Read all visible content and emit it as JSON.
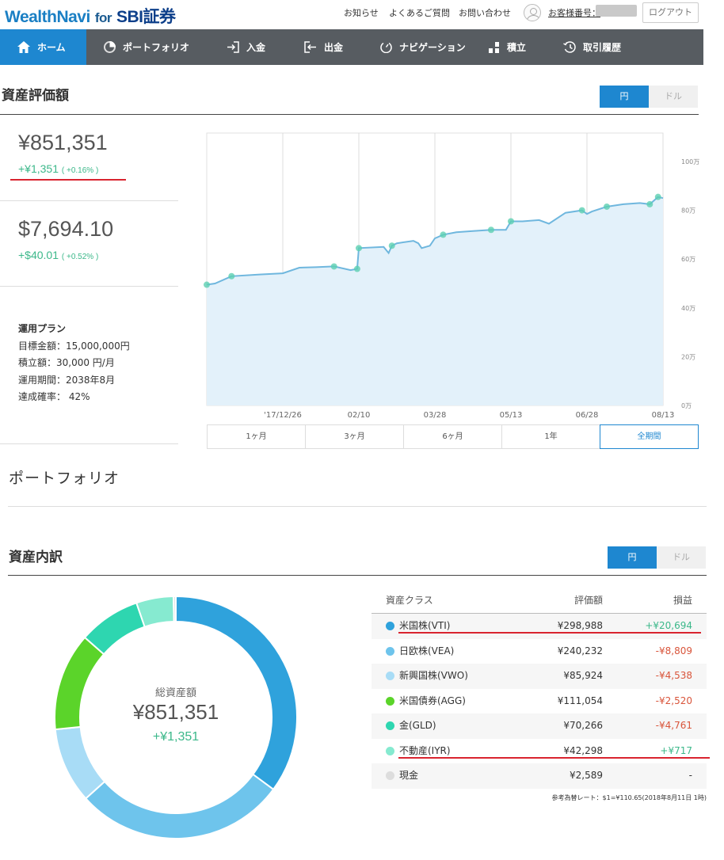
{
  "header": {
    "logo_main": "WealthNavi",
    "logo_for": "for",
    "logo_partner": "SBI証券",
    "links": [
      "お知らせ",
      "よくあるご質問",
      "お問い合わせ"
    ],
    "customer_label": "お客様番号：",
    "logout": "ログアウト"
  },
  "nav": [
    {
      "label": "ホーム",
      "icon": "home-icon",
      "active": true
    },
    {
      "label": "ポートフォリオ",
      "icon": "pie-icon",
      "active": false
    },
    {
      "label": "入金",
      "icon": "deposit-icon",
      "active": false
    },
    {
      "label": "出金",
      "icon": "withdraw-icon",
      "active": false
    },
    {
      "label": "ナビゲーション",
      "icon": "navigation-icon",
      "active": false
    },
    {
      "label": "積立",
      "icon": "stack-icon",
      "active": false
    },
    {
      "label": "取引履歴",
      "icon": "history-icon",
      "active": false
    }
  ],
  "assets": {
    "title": "資産評価額",
    "toggle": [
      "円",
      "ドル"
    ],
    "jpy_value": "¥851,351",
    "jpy_gain": "+¥1,351",
    "jpy_gain_pct": "( +0.16% )",
    "usd_value": "$7,694.10",
    "usd_gain": "+$40.01",
    "usd_gain_pct": "( +0.52% )"
  },
  "plan": {
    "title": "運用プラン",
    "target": "目標金額：15,000,000円",
    "monthly": "積立額：30,000 円/月",
    "period": "運用期間：2038年8月",
    "probability": "達成確率： 42%"
  },
  "chart_data": {
    "type": "area",
    "title": "",
    "xlabel": "",
    "ylabel": "",
    "x_ticks": [
      "'17/12/26",
      "02/10",
      "03/28",
      "05/13",
      "06/28",
      "08/13"
    ],
    "y_ticks": [
      "100万",
      "80万",
      "60万",
      "40万",
      "20万",
      "0万"
    ],
    "ylim": [
      0,
      100
    ],
    "y_unit": "万円",
    "grid": true,
    "x": [
      "2017-11-10",
      "2017-11-15",
      "2017-11-25",
      "2017-12-12",
      "2017-12-26",
      "2018-01-05",
      "2018-01-15",
      "2018-01-26",
      "2018-02-05",
      "2018-02-09",
      "2018-02-10",
      "2018-02-25",
      "2018-02-28",
      "2018-03-02",
      "2018-03-05",
      "2018-03-15",
      "2018-03-18",
      "2018-03-20",
      "2018-03-25",
      "2018-03-28",
      "2018-04-02",
      "2018-04-10",
      "2018-04-20",
      "2018-05-01",
      "2018-05-10",
      "2018-05-13",
      "2018-05-20",
      "2018-05-30",
      "2018-06-05",
      "2018-06-15",
      "2018-06-25",
      "2018-06-28",
      "2018-07-01",
      "2018-07-10",
      "2018-07-20",
      "2018-07-30",
      "2018-08-05",
      "2018-08-10",
      "2018-08-13"
    ],
    "values": [
      49.5,
      50,
      53,
      53.7,
      54.2,
      56.5,
      56.7,
      57,
      55.5,
      56,
      64.5,
      65,
      62.5,
      65.5,
      66.5,
      67.5,
      66.5,
      64.5,
      65.5,
      68.5,
      70,
      71,
      71.5,
      72,
      72,
      75.5,
      75.5,
      76,
      74.5,
      79,
      80,
      78.5,
      79.5,
      81.5,
      82.5,
      83,
      82.5,
      85.5,
      85
    ],
    "markers": [
      0,
      2,
      7,
      9,
      10,
      13,
      20,
      23,
      25,
      30,
      33,
      36,
      37
    ],
    "periods": [
      "1ヶ月",
      "3ヶ月",
      "6ヶ月",
      "1年",
      "全期間"
    ],
    "selected_period": "全期間"
  },
  "portfolio": {
    "title": "ポートフォリオ"
  },
  "breakdown": {
    "title": "資産内訳",
    "toggle": [
      "円",
      "ドル"
    ],
    "total_label": "総資産額",
    "total_value": "¥851,351",
    "total_gain": "+¥1,351",
    "headers": [
      "資産クラス",
      "評価額",
      "損益"
    ],
    "rows": [
      {
        "name": "米国株(VTI)",
        "color": "#2fa2dc",
        "value": "¥298,988",
        "pl": "+¥20,694",
        "sign": "pos",
        "amount": 298988
      },
      {
        "name": "日欧株(VEA)",
        "color": "#6ec4ec",
        "value": "¥240,232",
        "pl": "-¥8,809",
        "sign": "neg",
        "amount": 240232
      },
      {
        "name": "新興国株(VWO)",
        "color": "#a8dcf6",
        "value": "¥85,924",
        "pl": "-¥4,538",
        "sign": "neg",
        "amount": 85924
      },
      {
        "name": "米国債券(AGG)",
        "color": "#5bd42a",
        "value": "¥111,054",
        "pl": "-¥2,520",
        "sign": "neg",
        "amount": 111054
      },
      {
        "name": "金(GLD)",
        "color": "#2ed6b0",
        "value": "¥70,266",
        "pl": "-¥4,761",
        "sign": "neg",
        "amount": 70266
      },
      {
        "name": "不動産(IYR)",
        "color": "#86ead0",
        "value": "¥42,298",
        "pl": "+¥717",
        "sign": "pos",
        "amount": 42298
      },
      {
        "name": "現金",
        "color": "#dddddd",
        "value": "¥2,589",
        "pl": "-",
        "sign": "none",
        "amount": 2589
      }
    ],
    "fx_note": "参考為替レート：$1=¥110.65(2018年8月11日 1時)"
  }
}
